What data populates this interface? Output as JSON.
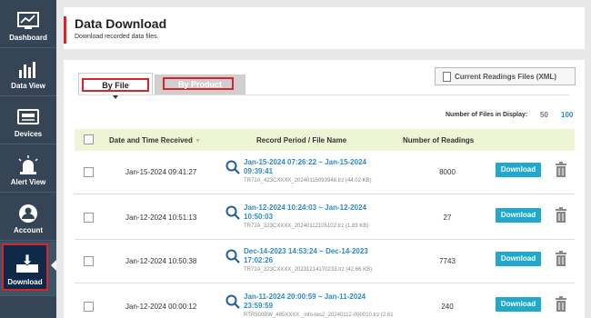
{
  "sidebar": {
    "items": [
      {
        "label": "Dashboard",
        "icon": "dashboard-icon"
      },
      {
        "label": "Data View",
        "icon": "bar-chart-icon"
      },
      {
        "label": "Devices",
        "icon": "device-icon"
      },
      {
        "label": "Alert View",
        "icon": "alert-light-icon"
      },
      {
        "label": "Account",
        "icon": "account-icon"
      },
      {
        "label": "Download",
        "icon": "download-tray-icon"
      }
    ]
  },
  "header": {
    "title": "Data Download",
    "subtitle": "Download recorded data files."
  },
  "tabs": {
    "by_file": "By File",
    "by_product": "By Product"
  },
  "xml_button": "Current Readings Files (XML)",
  "files_display": {
    "label": "Number of Files in Display:",
    "opt50": "50",
    "opt100": "100"
  },
  "table": {
    "headers": {
      "date": "Date and Time Received",
      "period": "Record Period / File Name",
      "readings": "Number of Readings"
    },
    "download_label": "Download",
    "rows": [
      {
        "date": "Jan-15-2024 09:41:27",
        "period": "Jan-15-2024 07:26:22 ~ Jan-15-2024 09:39:41",
        "file": "TR72A_423CXXXX_20240115093948.trz (44.02 KB)",
        "readings": "8000"
      },
      {
        "date": "Jan-12-2024 10:51:13",
        "period": "Jan-12-2024 10:24:03 ~ Jan-12-2024 10:50:03",
        "file": "TR72A_323CXXXX_20240112105102.trz (1.83 KB)",
        "readings": "27"
      },
      {
        "date": "Jan-12-2024 10:50:38",
        "period": "Dec-14-2023 14:53:24 ~ Dec-14-2023 17:02:26",
        "file": "TR72A_323CXXXX_20231214170233.trz (42.66 KB)",
        "readings": "7743"
      },
      {
        "date": "Jan-12-2024 00:00:12",
        "period": "Jan-11-2024 20:00:59 ~ Jan-11-2024 23:59:59",
        "file": "RTR500BW_485XXXX _info-tes2_20240112-000010.trz (2.61 KB)",
        "readings": "240"
      }
    ]
  },
  "colors": {
    "sidebar_bg": "#354555",
    "accent_red": "#d9232d",
    "link_blue": "#2a8bc9",
    "download_btn": "#20a9cf",
    "table_header_bg": "#eef5d5"
  }
}
